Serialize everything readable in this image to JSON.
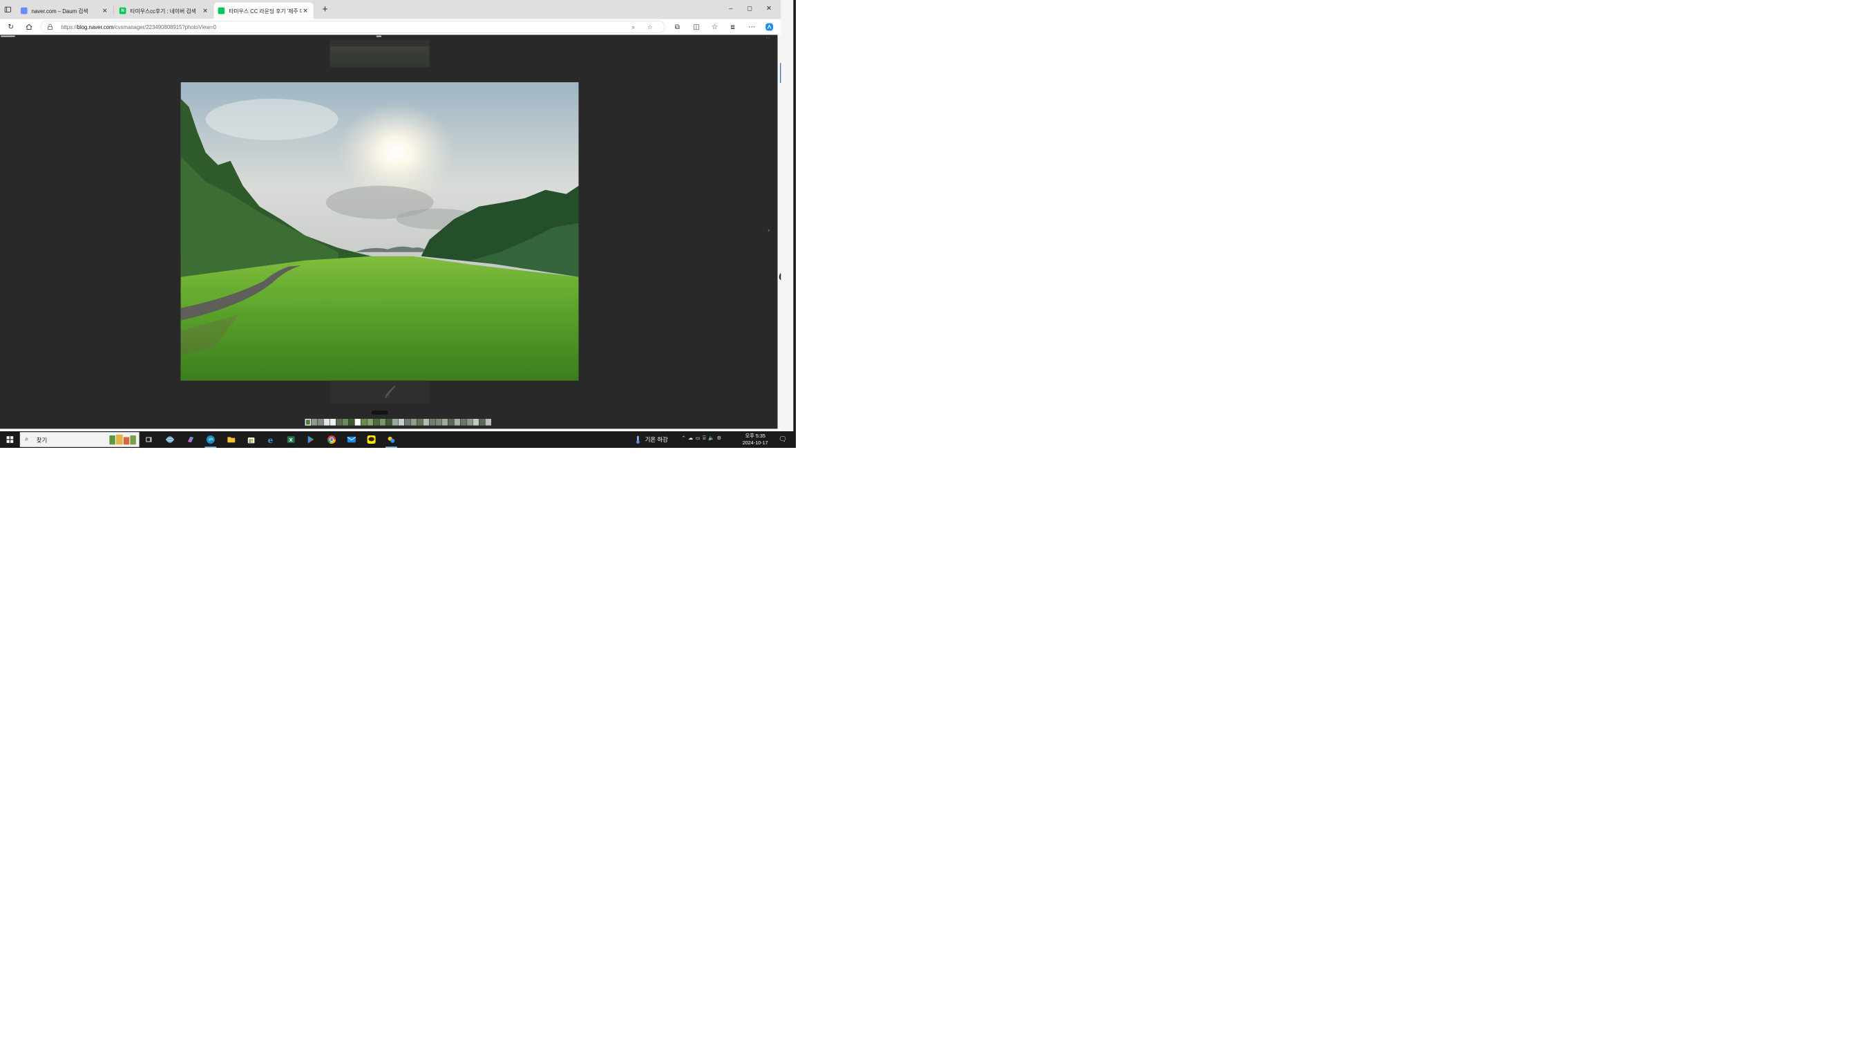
{
  "browser": {
    "tabs": [
      {
        "title": "naver.com – Daum 검색",
        "favicon": "daum-favicon",
        "color": "#6a8cff",
        "active": false
      },
      {
        "title": "타미우스cc후기 : 네이버 검색",
        "favicon": "naver-search-favicon",
        "color": "#03c75a",
        "active": false
      },
      {
        "title": "타미우스 CC 라운딩 후기 '제주 미",
        "favicon": "naver-blog-favicon",
        "color": "#03c75a",
        "active": true
      }
    ],
    "url_prefix": "https://",
    "url_host": "blog.naver.com",
    "url_path": "/cvsmanager/223490808915?photoView=0",
    "window_controls": {
      "minimize": "–",
      "maximize": "☐",
      "close": "✕"
    },
    "new_tab": "+"
  },
  "viewer": {
    "thumbnail_count": 30,
    "current_thumbnail_index": 0
  },
  "taskbar": {
    "search_label": "찾기",
    "weather_text": "기온 하강",
    "time": "오후 5:35",
    "date": "2024-10-17"
  },
  "colors": {
    "viewer_background": "#292929",
    "taskbar": "#1b1b1b",
    "titlebar": "#dfdfdf",
    "accent": "#1f5dc9"
  }
}
